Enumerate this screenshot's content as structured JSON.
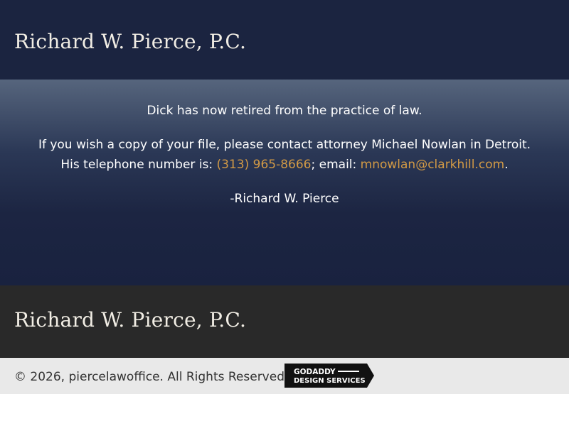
{
  "header": {
    "brand": "Richard W. Pierce, P.C."
  },
  "main": {
    "retired_message": "Dick has now retired from the practice of law.",
    "contact_prefix": "If you wish a copy of your file, please contact attorney Michael Nowlan in Detroit. His telephone number is: ",
    "phone": "(313) 965-8666",
    "email_prefix": "; email: ",
    "email": "mnowlan@clarkhill.com",
    "contact_suffix": ".",
    "signature": "-Richard W. Pierce"
  },
  "footer": {
    "brand": "Richard W. Pierce, P.C.",
    "copyright": "© 2026, piercelawoffice. All Rights Reserved.",
    "badge_line1": "GODADDY",
    "badge_line2": "DESIGN SERVICES"
  },
  "colors": {
    "header_bg": "#1b2440",
    "link": "#d39a45",
    "footer_dark": "#292929",
    "footer_light": "#e9e9e9"
  }
}
